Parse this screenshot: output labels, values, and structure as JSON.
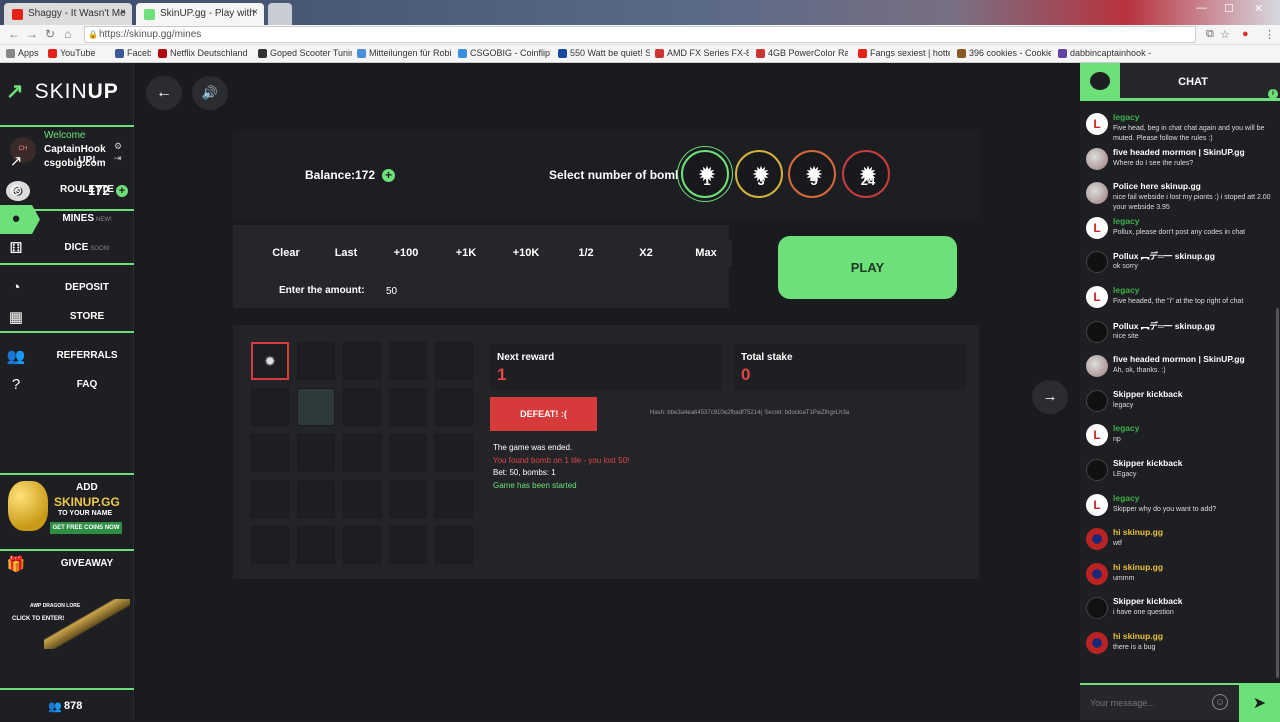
{
  "browser": {
    "tabs": [
      {
        "title": "Shaggy - It Wasn't Me",
        "active": false
      },
      {
        "title": "SkinUP.gg - Play with",
        "active": true
      }
    ],
    "url": "https://skinup.gg/mines",
    "bookmarks": [
      "Apps",
      "YouTube",
      "Facebook",
      "Netflix Deutschland -",
      "Goped Scooter Tuning",
      "Mitteilungen für Robi",
      "CSGOBIG - Coinflip M",
      "550 Watt be quiet! Sy",
      "AMD FX Series FX-83",
      "4GB PowerColor Rade",
      "Fangs sexiest | hottes",
      "396 cookies - Cookie",
      "dabbincaptainhook -"
    ]
  },
  "sidebar": {
    "logo_left": "SKIN",
    "logo_right": "UP",
    "welcome": "Welcome",
    "username": "CaptainHook",
    "usersite": "csgobig.com",
    "balance": "172",
    "nav": [
      {
        "label": "UP!",
        "badge": "",
        "icon": "trend-icon"
      },
      {
        "label": "ROULETTE",
        "badge": "",
        "icon": "roulette-icon"
      },
      {
        "label": "MINES",
        "badge": "NEW!",
        "icon": "bomb-icon"
      },
      {
        "label": "DICE",
        "badge": "SOON!",
        "icon": "dice-icon"
      },
      {
        "label": "DEPOSIT",
        "badge": "",
        "icon": "deposit-icon"
      },
      {
        "label": "STORE",
        "badge": "",
        "icon": "store-icon"
      },
      {
        "label": "REFERRALS",
        "badge": "",
        "icon": "referrals-icon"
      },
      {
        "label": "FAQ",
        "badge": "",
        "icon": "help-icon"
      }
    ],
    "promo": {
      "l1": "ADD",
      "l2": "SKINUP.GG",
      "l3": "TO YOUR NAME",
      "l4": "GET FREE COINS NOW"
    },
    "giveaway": "GIVEAWAY",
    "giveaway_text1": "AWP DRAGON LORE",
    "giveaway_text2": "CLICK TO ENTER!",
    "online": "878"
  },
  "game": {
    "balance_label": "Balance:",
    "balance_value": "172",
    "bombs_label": "Select number of bombs",
    "bomb_options": [
      "1",
      "3",
      "5",
      "24"
    ],
    "bomb_colors": [
      "#6ee07a",
      "#d4b13a",
      "#d46a3a",
      "#c83c3c"
    ],
    "selected_bombs": "1",
    "quick_buttons": [
      "Clear",
      "Last",
      "+100",
      "+1K",
      "+10K",
      "1/2",
      "X2",
      "Max"
    ],
    "amount_label": "Enter the amount:",
    "amount_value": "50",
    "play": "PLAY",
    "next_reward_label": "Next reward",
    "next_reward_value": "1",
    "total_stake_label": "Total stake",
    "total_stake_value": "0",
    "defeat": "DEFEAT! :(",
    "hash": "Hash: bbe3a4ea64537c910e2fbadf75214( Secret: bdocloaT1PwZihgxLh3a",
    "logs": [
      {
        "text": "The game was ended.",
        "color": "#ffffff"
      },
      {
        "text": "You found bomb on 1 tile - you lost 50!",
        "color": "#e04646"
      },
      {
        "text": "Bet: 50, bombs: 1",
        "color": "#ffffff"
      },
      {
        "text": "Game has been started",
        "color": "#6ee07a"
      }
    ]
  },
  "chat": {
    "title": "CHAT",
    "placeholder": "Your message...",
    "messages": [
      {
        "name": "legacy",
        "name_color": "#3fae4a",
        "avatar": "l",
        "text": "Five head, beg in chat chat again and you will be muted. Please follow the rules :)"
      },
      {
        "name": "five headed mormon | SkinUP.gg",
        "name_color": "#ffffff",
        "avatar": "face",
        "text": "Where do I see the rules?"
      },
      {
        "name": "Police here skinup.gg",
        "name_color": "#ffffff",
        "avatar": "face",
        "text": "nice fail webside i lost my pionts :) i stoped att 2.00 your webside 3.95"
      },
      {
        "name": "legacy",
        "name_color": "#3fae4a",
        "avatar": "l",
        "text": "Pollux, please don't post any codes in chat"
      },
      {
        "name": "Pollux ︻デ═一 skinup.gg",
        "name_color": "#ffffff",
        "avatar": "dark",
        "text": "ok sorry"
      },
      {
        "name": "legacy",
        "name_color": "#3fae4a",
        "avatar": "l",
        "text": "Five headed, the \"i\" at the top right of chat"
      },
      {
        "name": "Pollux ︻デ═一 skinup.gg",
        "name_color": "#ffffff",
        "avatar": "dark",
        "text": "nice site"
      },
      {
        "name": "five headed mormon | SkinUP.gg",
        "name_color": "#ffffff",
        "avatar": "face",
        "text": "Ah, ok, thanks. :)"
      },
      {
        "name": "Skipper kickback",
        "name_color": "#ffffff",
        "avatar": "dark",
        "text": "legacy"
      },
      {
        "name": "legacy",
        "name_color": "#3fae4a",
        "avatar": "l",
        "text": "np"
      },
      {
        "name": "Skipper kickback",
        "name_color": "#ffffff",
        "avatar": "dark",
        "text": "LEgacy"
      },
      {
        "name": "legacy",
        "name_color": "#3fae4a",
        "avatar": "l",
        "text": "Skipper why do you want to add?"
      },
      {
        "name": "hi skinup.gg",
        "name_color": "#e8c13a",
        "avatar": "flag",
        "text": "wtf"
      },
      {
        "name": "hi skinup.gg",
        "name_color": "#e8c13a",
        "avatar": "flag",
        "text": "ummm"
      },
      {
        "name": "Skipper kickback",
        "name_color": "#ffffff",
        "avatar": "dark",
        "text": "i have one question"
      },
      {
        "name": "hi skinup.gg",
        "name_color": "#e8c13a",
        "avatar": "flag",
        "text": "there is a bug"
      }
    ]
  },
  "accent": "#6ee07a",
  "danger": "#d63a3a"
}
